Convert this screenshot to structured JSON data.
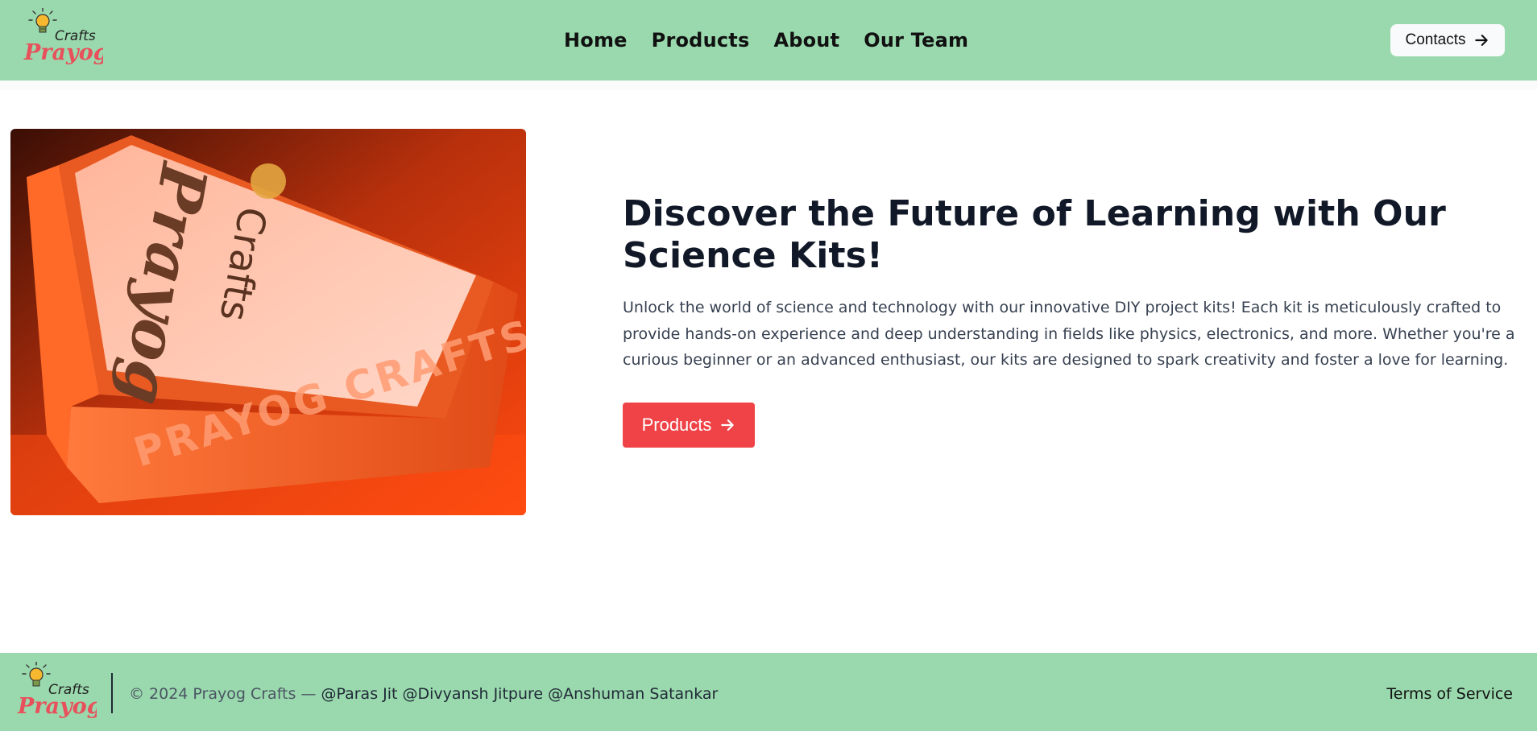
{
  "brand": {
    "logo_word_top": "Crafts",
    "logo_word_bottom": "Prayog",
    "logo_icon": "lightbulb-icon"
  },
  "nav": {
    "items": [
      {
        "label": "Home"
      },
      {
        "label": "Products"
      },
      {
        "label": "About"
      },
      {
        "label": "Our Team"
      }
    ],
    "contacts_label": "Contacts"
  },
  "hero": {
    "image_box_text_top": "Crafts",
    "image_box_text_main": "Prayog",
    "image_box_side_text": "PRAYOG CRAFTS",
    "title": "Discover the Future of Learning with Our Science Kits!",
    "description": "Unlock the world of science and technology with our innovative DIY project kits! Each kit is meticulously crafted to provide hands-on experience and deep understanding in fields like physics, electronics, and more. Whether you're a curious beginner or an advanced enthusiast, our kits are designed to spark creativity and foster a love for learning.",
    "cta_label": "Products"
  },
  "footer": {
    "copyright": "© 2024 Prayog Crafts —",
    "authors": "@Paras Jit @Divyansh Jitpure @Anshuman Satankar",
    "terms_label": "Terms of Service"
  },
  "colors": {
    "header_bg": "#9ad9ad",
    "footer_bg": "#9ad9ad",
    "accent_red": "#ef4347",
    "logo_red": "#e8505b",
    "bulb_yellow": "#f5b82e"
  }
}
